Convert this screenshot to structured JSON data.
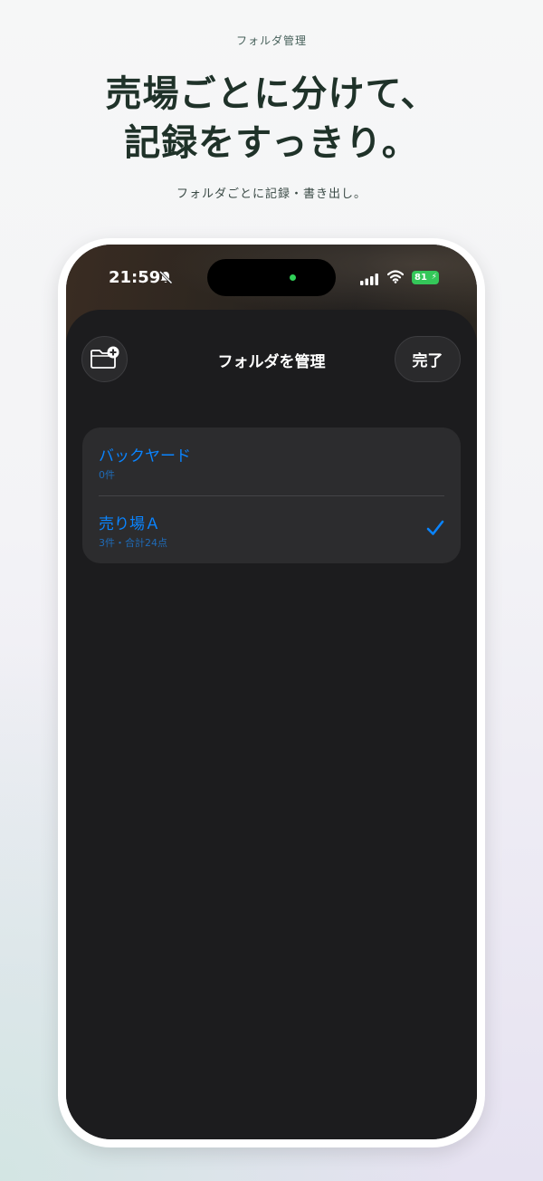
{
  "hero": {
    "label": "フォルダ管理",
    "title_line1": "売場ごとに分けて、",
    "title_line2": "記録をすっきり。",
    "subtitle": "フォルダごとに記録・書き出し。"
  },
  "status_bar": {
    "time": "21:59",
    "battery": "81",
    "icons": [
      "bell-slash-icon",
      "signal-icon",
      "wifi-icon",
      "battery-icon"
    ]
  },
  "sheet": {
    "title": "フォルダを管理",
    "done_label": "完了",
    "add_icon": "folder-plus-icon"
  },
  "folders": [
    {
      "name": "バックヤード",
      "detail": "0件",
      "selected": false
    },
    {
      "name": "売り場Ａ",
      "detail": "3件・合計24点",
      "selected": true
    }
  ],
  "colors": {
    "accent": "#0a84ff",
    "sheet_bg": "#1c1c1e",
    "list_bg": "#2c2c2e",
    "battery": "#34c759",
    "hero_title": "#1f3229"
  }
}
